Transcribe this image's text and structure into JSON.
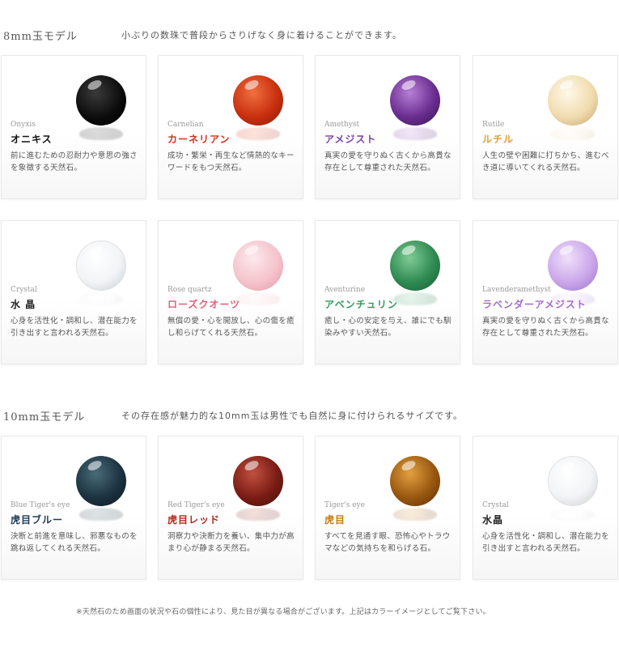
{
  "sections": [
    {
      "title": "8mm玉モデル",
      "description": "小ぶりの数珠で普段からさりげなく身に着けることができます。",
      "cards": [
        {
          "en": "Onyxis",
          "jp": "オニキス",
          "jp_color": "#111111",
          "stone": "onyx",
          "desc": "前に進むための忍耐力や意思の強さを象徴する天然石。"
        },
        {
          "en": "Carnelian",
          "jp": "カーネリアン",
          "jp_color": "#d0321a",
          "stone": "carnelian",
          "desc": "成功・繁栄・再生など情熱的なキーワードをもつ天然石。"
        },
        {
          "en": "Amethyst",
          "jp": "アメジスト",
          "jp_color": "#7a3fa8",
          "stone": "amethyst",
          "desc": "真実の愛を守りぬく古くから高貴な存在として尊重された天然石。"
        },
        {
          "en": "Rutile",
          "jp": "ルチル",
          "jp_color": "#e0a03a",
          "stone": "rutile",
          "desc": "人生の壁や困難に打ちかち、進むべき道に導いてくれる天然石。"
        },
        {
          "en": "Crystal",
          "jp": "水 晶",
          "jp_color": "#222222",
          "stone": "crystal",
          "desc": "心身を活性化・調和し、潜在能力を引き出すと言われる天然石。"
        },
        {
          "en": "Rose quartz",
          "jp": "ローズクオーツ",
          "jp_color": "#e0607a",
          "stone": "rose",
          "desc": "無償の愛・心を開放し、心の傷を癒し和らげてくれる天然石。"
        },
        {
          "en": "Aventurine",
          "jp": "アベンチュリン",
          "jp_color": "#2f9a5a",
          "stone": "aventurine",
          "desc": "癒し・心の安定を与え、誰にでも馴染みやすい天然石。"
        },
        {
          "en": "Lavenderamethyst",
          "jp": "ラベンダーアメジスト",
          "jp_color": "#a56ad0",
          "stone": "lavender",
          "desc": "真実の愛を守りぬく古くから高貴な存在として尊重された天然石。"
        }
      ]
    },
    {
      "title": "10mm玉モデル",
      "description": "その存在感が魅力的な10mm玉は男性でも自然に身に付けられるサイズです。",
      "cards": [
        {
          "en": "Blue Tiger's eye",
          "jp": "虎目ブルー",
          "jp_color": "#1f3a5a",
          "stone": "bluetiger",
          "desc": "決断と前進を意味し、邪悪なものを跳ね返してくれる天然石。"
        },
        {
          "en": "Red Tiger's eye",
          "jp": "虎目レッド",
          "jp_color": "#b02a1a",
          "stone": "redtiger",
          "desc": "洞察力や決断力を養い、集中力が高まり心が静まる天然石。"
        },
        {
          "en": "Tiger's eye",
          "jp": "虎目",
          "jp_color": "#c87a12",
          "stone": "tiger",
          "desc": "すべてを見通す眼、恐怖心やトラウマなどの気持ちを和らげる石。"
        },
        {
          "en": "Crystal",
          "jp": "水晶",
          "jp_color": "#222222",
          "stone": "crystal",
          "desc": "心身を活性化・調和し、潜在能力を引き出すと言われる天然石。"
        }
      ]
    }
  ],
  "footnote": "※天然石のため画面の状況や石の個性により、見た目が異なる場合がございます。上記はカラーイメージとしてご覧下さい。"
}
